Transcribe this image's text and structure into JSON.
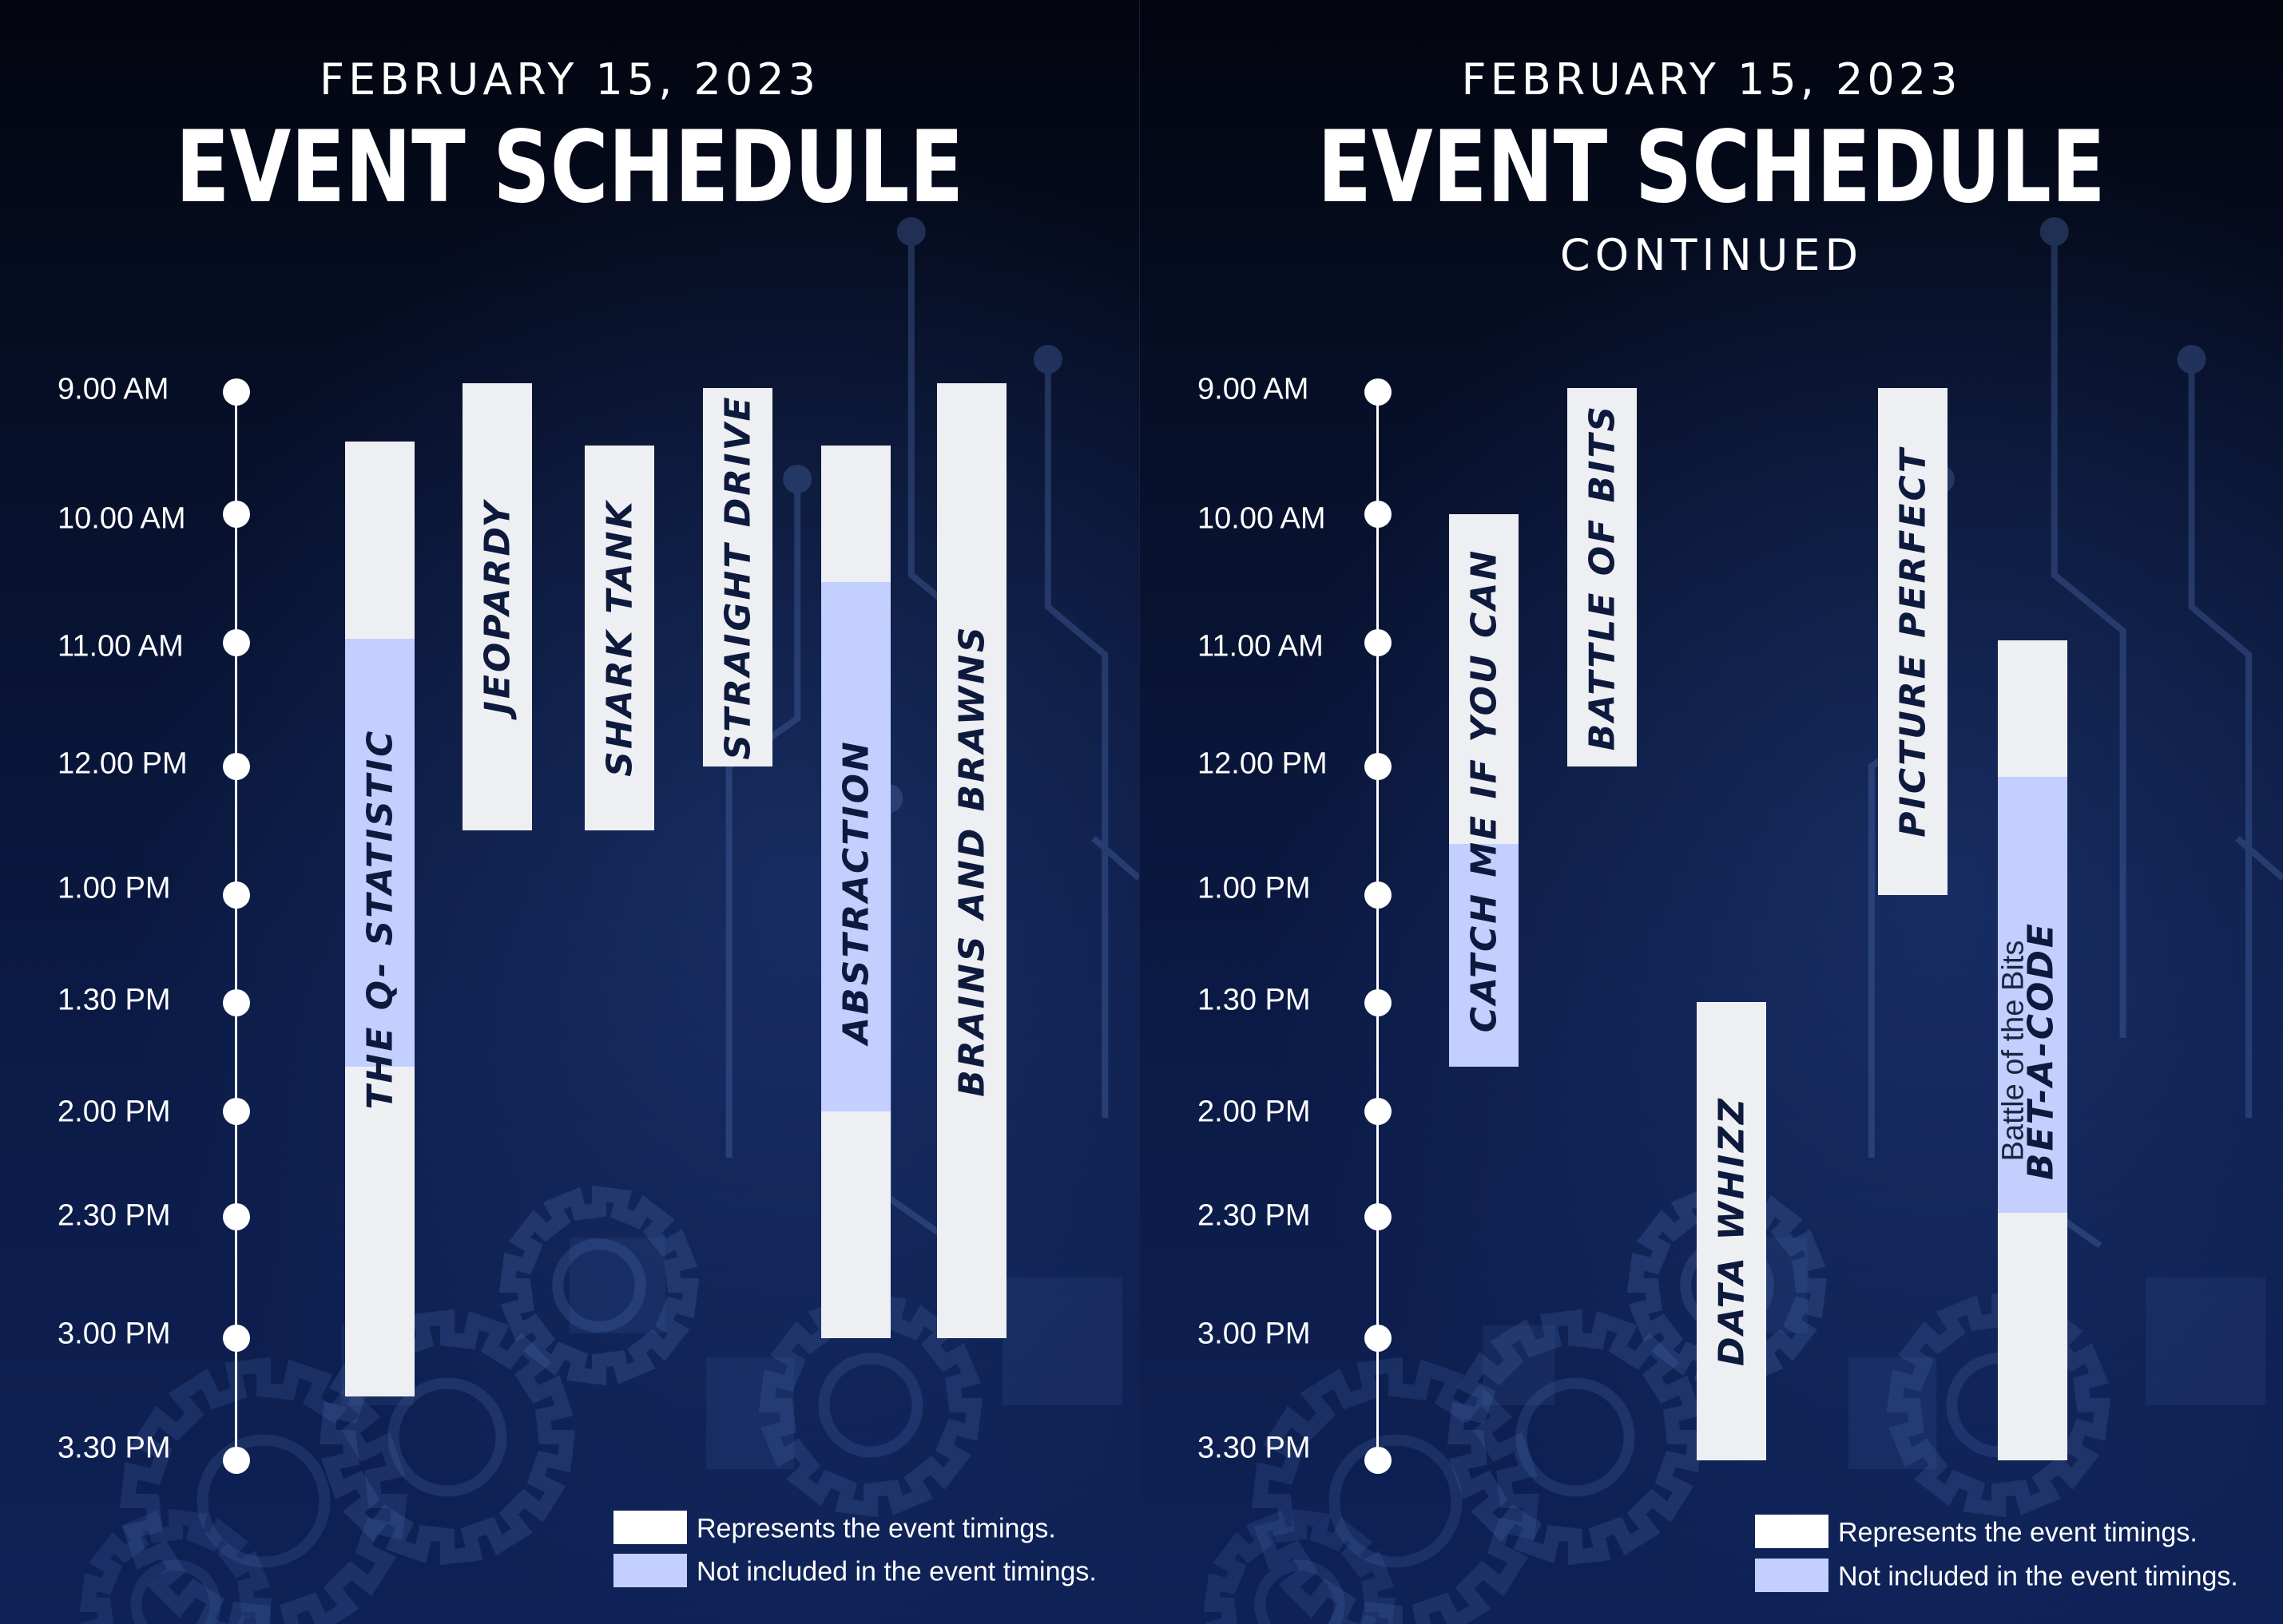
{
  "colors": {
    "event_timing": "#eeeff2",
    "not_included": "#c3d0ff",
    "text": "#ffffff",
    "bar_text": "#0e1a3d"
  },
  "icons": [
    "gear-icon",
    "circuit-trace-icon"
  ],
  "pages": [
    {
      "date": "FEBRUARY 15, 2023",
      "title": "EVENT SCHEDULE",
      "subtitle": "",
      "times": [
        "9.00 AM",
        "10.00 AM",
        "11.00 AM",
        "12.00 PM",
        "1.00 PM",
        "1.30 PM",
        "2.00 PM",
        "2.30 PM",
        "3.00 PM",
        "3.30 PM"
      ],
      "events": [
        {
          "name": "THE Q- STATISTIC"
        },
        {
          "name": "JEOPARDY"
        },
        {
          "name": "SHARK TANK"
        },
        {
          "name": "STRAIGHT DRIVE"
        },
        {
          "name": "ABSTRACTION"
        },
        {
          "name": "BRAINS AND BRAWNS"
        }
      ],
      "legend": {
        "event_timings": "Represents the event timings.",
        "not_included": "Not included in the event timings."
      }
    },
    {
      "date": "FEBRUARY 15, 2023",
      "title": "EVENT SCHEDULE",
      "subtitle": "CONTINUED",
      "times": [
        "9.00 AM",
        "10.00 AM",
        "11.00 AM",
        "12.00 PM",
        "1.00 PM",
        "1.30 PM",
        "2.00 PM",
        "2.30 PM",
        "3.00 PM",
        "3.30 PM"
      ],
      "events": [
        {
          "name": "CATCH ME IF YOU CAN"
        },
        {
          "name": "BATTLE OF BITS"
        },
        {
          "name": "DATA WHIZZ"
        },
        {
          "name": "PICTURE PERFECT"
        },
        {
          "name": "BET-A-CODE",
          "overlay_text": "Battle of the Bits"
        }
      ],
      "legend": {
        "event_timings": "Represents the event timings.",
        "not_included": "Not included in the event timings."
      }
    }
  ]
}
